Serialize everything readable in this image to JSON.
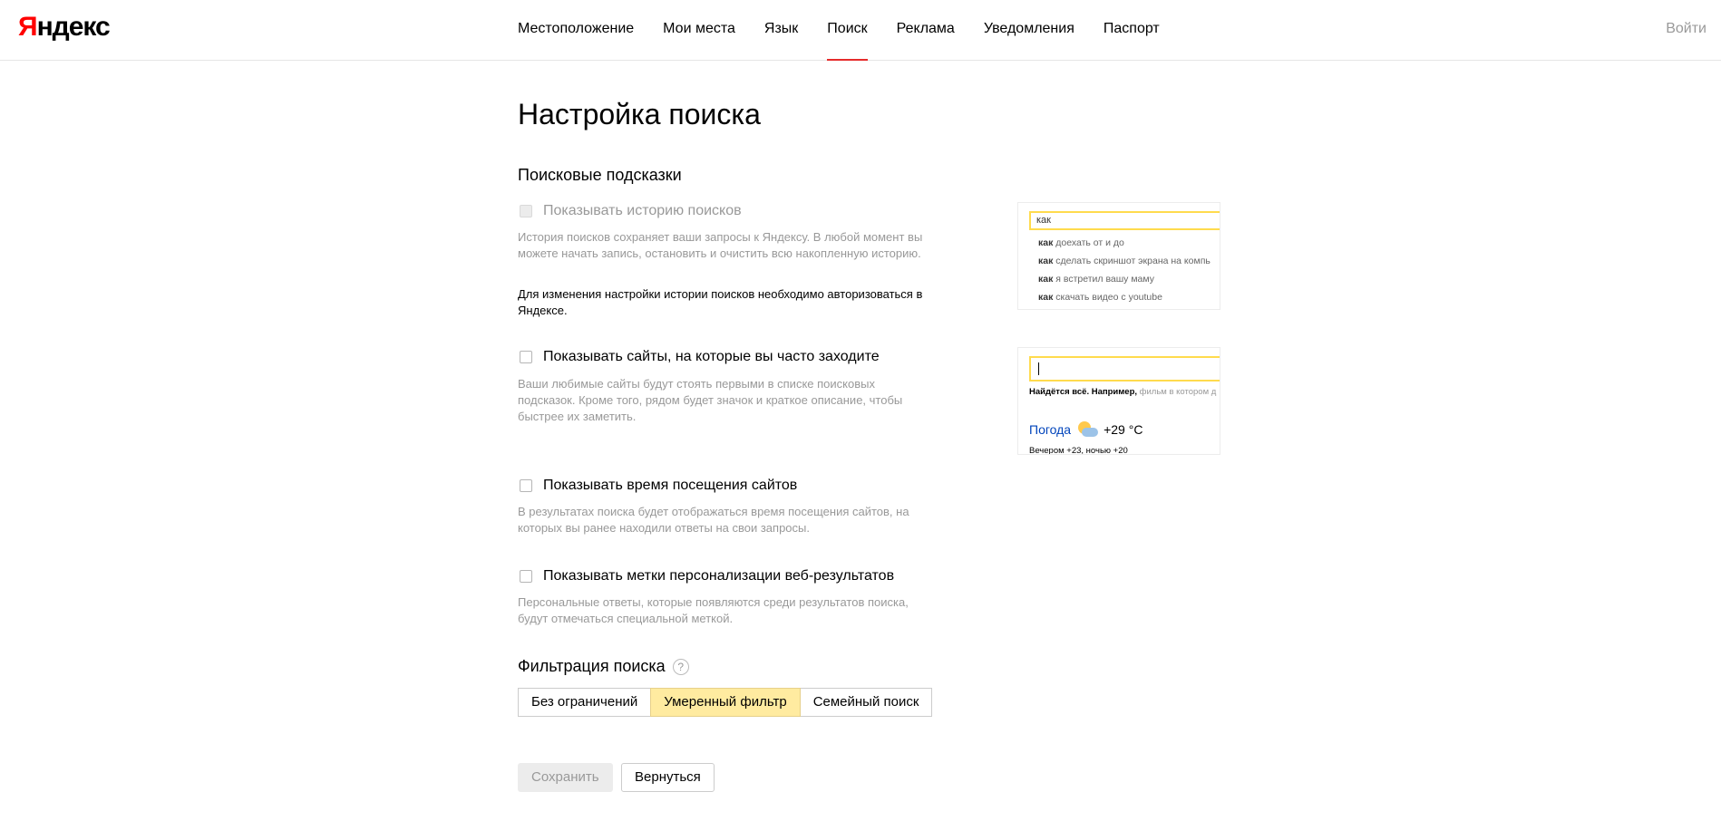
{
  "header": {
    "logo_first": "Я",
    "logo_rest": "ндекс",
    "nav": [
      "Местоположение",
      "Мои места",
      "Язык",
      "Поиск",
      "Реклама",
      "Уведомления",
      "Паспорт"
    ],
    "active_nav": "Поиск",
    "login": "Войти"
  },
  "page": {
    "title": "Настройка поиска",
    "suggest_section": "Поисковые подсказки",
    "options": {
      "history": {
        "label": "Показывать историю поисков",
        "desc": "История поисков сохраняет ваши запросы к Яндексу. В любой момент вы можете начать запись, остановить и очистить всю накопленную историю.",
        "note": "Для изменения настройки истории поисков необходимо авторизоваться в Яндексе.",
        "checked": false,
        "disabled": true
      },
      "sites": {
        "label": "Показывать сайты, на которые вы часто заходите",
        "desc": "Ваши любимые сайты будут стоять первыми в списке поисковых подсказок. Кроме того, рядом будет значок и краткое описание, чтобы быстрее их заметить.",
        "checked": false
      },
      "visit_time": {
        "label": "Показывать время посещения сайтов",
        "desc": "В результатах поиска будет отображаться время посещения сайтов, на которых вы ранее находили ответы на свои запросы.",
        "checked": false
      },
      "personal": {
        "label": "Показывать метки персонализации веб-результатов",
        "desc": "Персональные ответы, которые появляются среди результатов поиска, будут отмечаться специальной меткой.",
        "checked": false
      }
    },
    "preview1": {
      "query": "как",
      "suggestions": [
        {
          "bold": "как",
          "rest": " доехать от и до"
        },
        {
          "bold": "как",
          "rest": " сделать скриншот экрана на компь"
        },
        {
          "bold": "как",
          "rest": " я встретил вашу маму"
        },
        {
          "bold": "как",
          "rest": " скачать видео с youtube"
        }
      ]
    },
    "preview2": {
      "hint_main": "Найдётся всё. Например,",
      "hint_example": " фильм в котором д",
      "weather_link": "Погода",
      "weather_temp": "+29 °C",
      "weather_sub": "Вечером +23,  ночью +20"
    },
    "filter": {
      "title": "Фильтрация поиска",
      "help": "?",
      "options": [
        "Без ограничений",
        "Умеренный фильтр",
        "Семейный поиск"
      ],
      "selected": "Умеренный фильтр"
    },
    "buttons": {
      "save": "Сохранить",
      "back": "Вернуться"
    }
  }
}
